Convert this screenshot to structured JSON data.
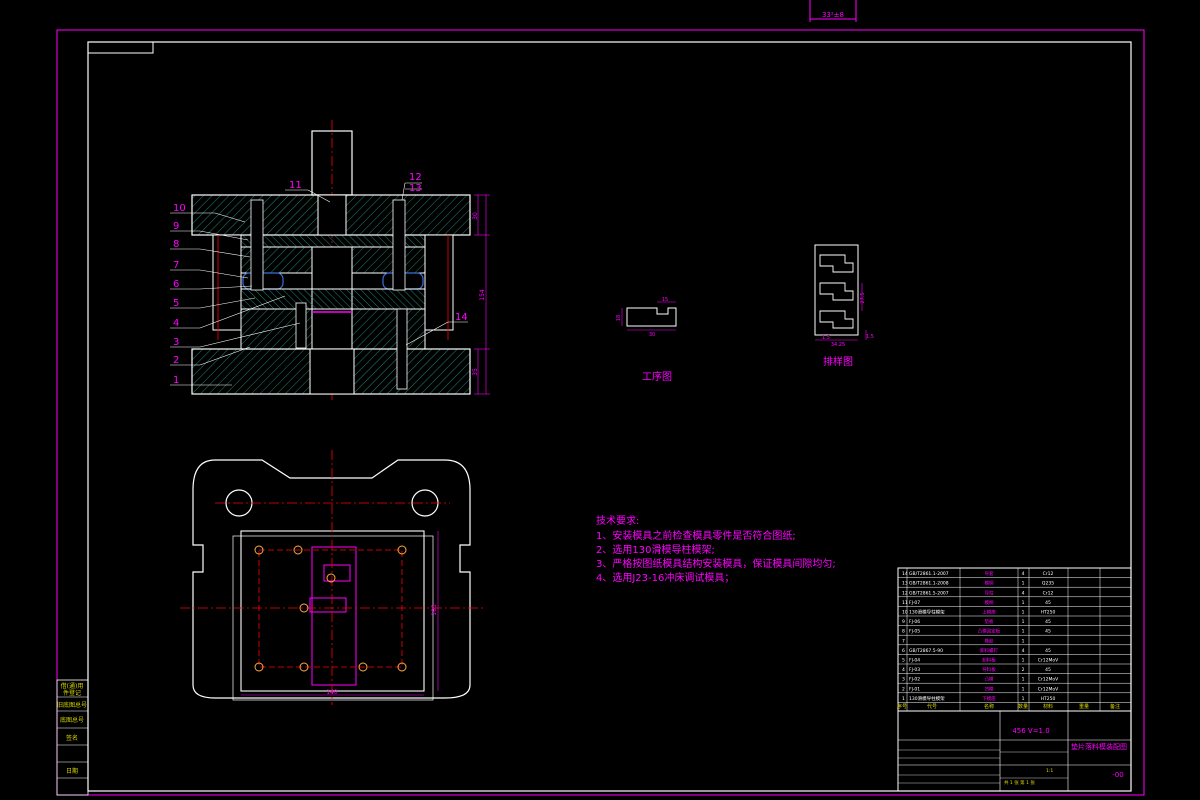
{
  "top_dimension": "33²±8",
  "section_view": {
    "part_numbers": [
      "1",
      "2",
      "3",
      "4",
      "5",
      "6",
      "7",
      "8",
      "9",
      "10",
      "11",
      "12",
      "13",
      "14"
    ],
    "dims": {
      "top_plate": "30",
      "total_height": "154",
      "base": "35"
    }
  },
  "process_drawing": {
    "title": "工序图",
    "dims": {
      "slot": "15",
      "width": "30",
      "height": "18"
    }
  },
  "strip_layout": {
    "title": "排样图",
    "dims": {
      "pitch": "27.5",
      "bottom_a": "1.5",
      "bottom_b": "34.25",
      "side": "1.5"
    }
  },
  "plan_view": {
    "dims": {
      "width": "140",
      "height": "183"
    }
  },
  "tech_requirements": {
    "title": "技术要求:",
    "items": [
      "1、安装模具之前检查模具零件是否符合图纸;",
      "2、选用130滑模导柱模架;",
      "3、严格按图纸模具结构安装模具，保证模具间隙均匀;",
      "4、选用J23-16冲床调试模具；"
    ]
  },
  "bom": {
    "rows": [
      {
        "no": "14",
        "code": "GB/T2861.1-2007",
        "name": "导套",
        "qty": "4",
        "material": "Cr12"
      },
      {
        "no": "13",
        "code": "GB/T2861.1-2008",
        "name": "模柄",
        "qty": "1",
        "material": "Q235"
      },
      {
        "no": "12",
        "code": "GB/T2861.5-2007",
        "name": "导柱",
        "qty": "4",
        "material": "Cr12"
      },
      {
        "no": "11",
        "code": "FJ-07",
        "name": "模柄",
        "qty": "1",
        "material": "45"
      },
      {
        "no": "10",
        "code": "130滑模导柱模架",
        "name": "上模座",
        "qty": "1",
        "material": "HT250"
      },
      {
        "no": "9",
        "code": "FJ-06",
        "name": "垫板",
        "qty": "1",
        "material": "45"
      },
      {
        "no": "8",
        "code": "FJ-05",
        "name": "凸模固定板",
        "qty": "1",
        "material": "45"
      },
      {
        "no": "7",
        "code": "",
        "name": "橡胶",
        "qty": "1",
        "material": ""
      },
      {
        "no": "6",
        "code": "GB/T2867.5-90",
        "name": "卸料螺钉",
        "qty": "4",
        "material": "45"
      },
      {
        "no": "5",
        "code": "FJ-04",
        "name": "卸料板",
        "qty": "1",
        "material": "Cr12MoV"
      },
      {
        "no": "4",
        "code": "FJ-03",
        "name": "导料板",
        "qty": "2",
        "material": "45"
      },
      {
        "no": "3",
        "code": "FJ-02",
        "name": "凸模",
        "qty": "1",
        "material": "Cr12MoV"
      },
      {
        "no": "2",
        "code": "FJ-01",
        "name": "凹模",
        "qty": "1",
        "material": "Cr12MoV"
      },
      {
        "no": "1",
        "code": "130滑模导柱模架",
        "name": "下模座",
        "qty": "1",
        "material": "HT250"
      }
    ],
    "headers": [
      "序号",
      "代号",
      "名称",
      "数量",
      "材料",
      "重量",
      "备注"
    ]
  },
  "title_block": {
    "drawing_title": "垫片落料模装配图",
    "drawing_number": "-00",
    "scale_label": "456 V=1.0",
    "scale_value": "1:1",
    "sheet_info": "共 1 张   第 1 张"
  },
  "left_stamp": [
    "借(通)用",
    "件登记",
    "旧底图总号",
    "底图总号",
    "签名",
    "日期"
  ]
}
